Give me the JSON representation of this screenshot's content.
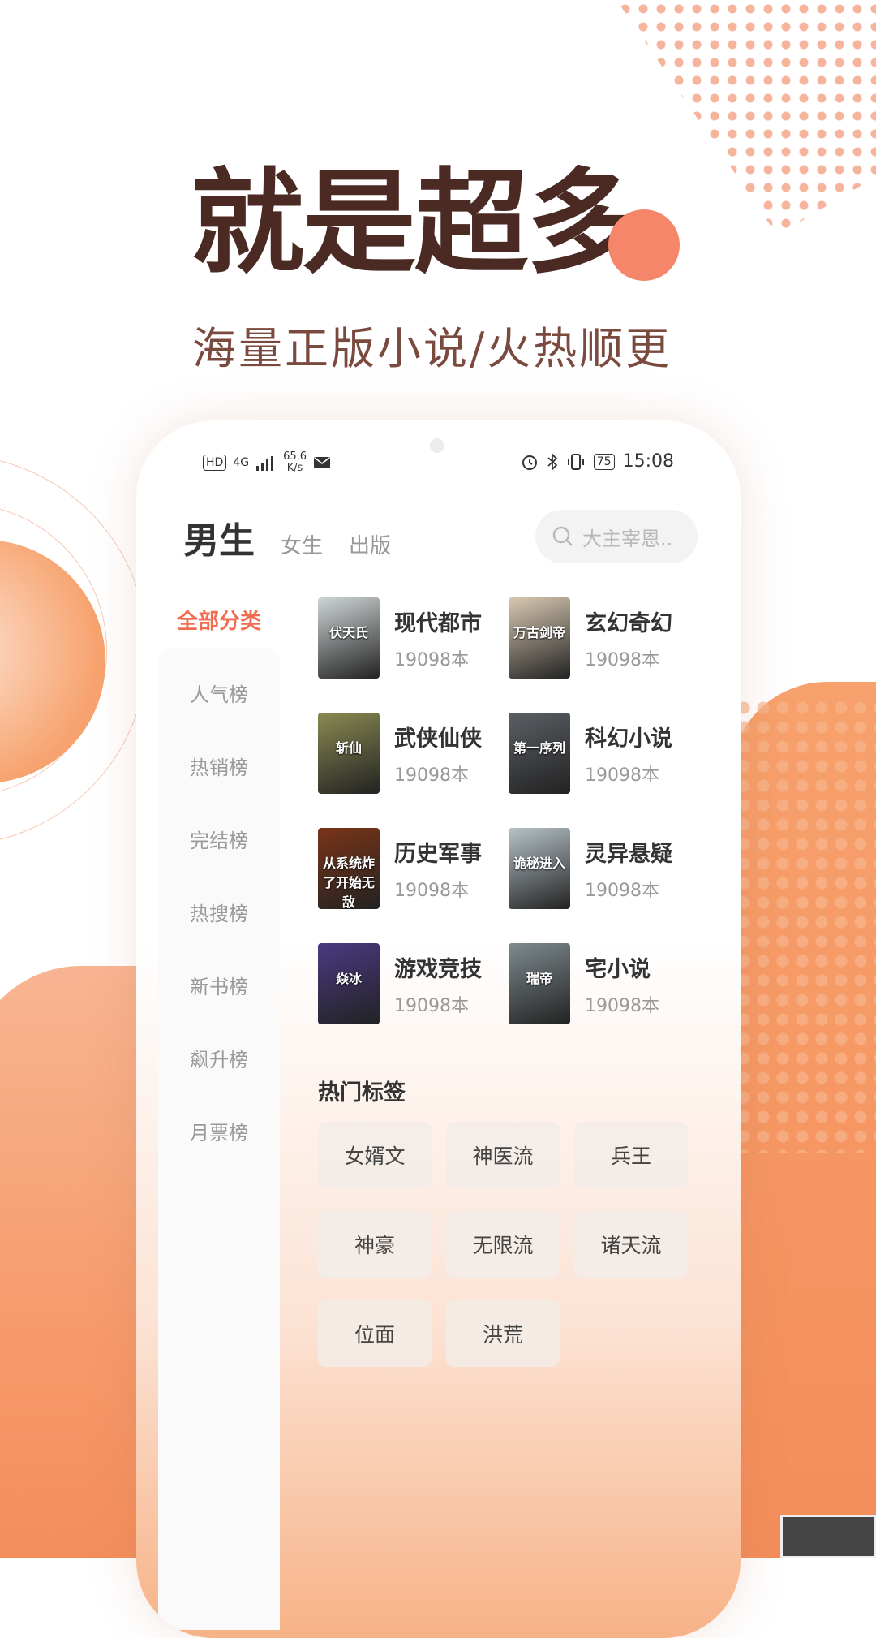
{
  "headline": "就是超多",
  "subheadline": "海量正版小说/火热顺更",
  "status_bar": {
    "network_badge": "HD",
    "network_type": "4G",
    "speed_value": "65.6",
    "speed_unit": "K/s",
    "battery": "75",
    "time": "15:08"
  },
  "tabs": {
    "active": "男生",
    "others": [
      "女生",
      "出版"
    ]
  },
  "search": {
    "placeholder": "大主宰恩.."
  },
  "sidebar": {
    "active": "全部分类",
    "items": [
      "人气榜",
      "热销榜",
      "完结榜",
      "热搜榜",
      "新书榜",
      "飙升榜",
      "月票榜"
    ]
  },
  "categories": [
    {
      "name": "现代都市",
      "count": "19098本",
      "cover_text": "伏天氏",
      "cover_color": "#cfd5d6"
    },
    {
      "name": "玄幻奇幻",
      "count": "19098本",
      "cover_text": "万古剑帝",
      "cover_color": "#d9c9b2"
    },
    {
      "name": "武侠仙侠",
      "count": "19098本",
      "cover_text": "斩仙",
      "cover_color": "#8a8a52"
    },
    {
      "name": "科幻小说",
      "count": "19098本",
      "cover_text": "第一序列",
      "cover_color": "#5b5f64"
    },
    {
      "name": "历史军事",
      "count": "19098本",
      "cover_text": "从系统炸了开始无敌",
      "cover_color": "#7a3418"
    },
    {
      "name": "灵异悬疑",
      "count": "19098本",
      "cover_text": "诡秘进入",
      "cover_color": "#b6c2c8"
    },
    {
      "name": "游戏竞技",
      "count": "19098本",
      "cover_text": "焱冰",
      "cover_color": "#4a3a82"
    },
    {
      "name": "宅小说",
      "count": "19098本",
      "cover_text": "瑞帝",
      "cover_color": "#7e8a8e"
    }
  ],
  "hot_tags": {
    "title": "热门标签",
    "items": [
      "女婿文",
      "神医流",
      "兵王",
      "神豪",
      "无限流",
      "诸天流",
      "位面",
      "洪荒"
    ]
  },
  "colors": {
    "accent": "#f26d4f",
    "headline": "#4b2a24",
    "orange": "#f69a6a"
  }
}
